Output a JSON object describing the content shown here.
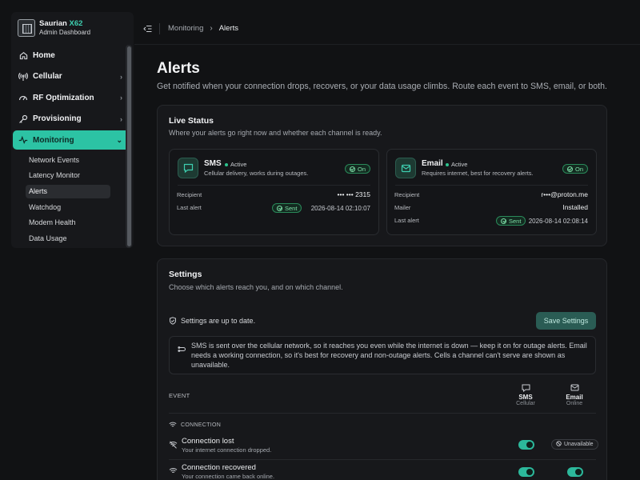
{
  "brand": {
    "name": "Saurian",
    "model": "X62",
    "subtitle": "Admin Dashboard",
    "logo_icon": "device-chip-icon"
  },
  "sidebar": {
    "items": [
      {
        "label": "Home",
        "icon": "home-icon",
        "expandable": false
      },
      {
        "label": "Cellular",
        "icon": "antenna-icon",
        "expandable": true
      },
      {
        "label": "RF Optimization",
        "icon": "gauge-icon",
        "expandable": true
      },
      {
        "label": "Provisioning",
        "icon": "key-icon",
        "expandable": true
      },
      {
        "label": "Monitoring",
        "icon": "pulse-icon",
        "expandable": true,
        "active": true
      }
    ],
    "sub_items": [
      "Network Events",
      "Latency Monitor",
      "Alerts",
      "Watchdog",
      "Modem Health",
      "Data Usage"
    ],
    "active_sub": "Alerts"
  },
  "breadcrumb": {
    "parent": "Monitoring",
    "current": "Alerts"
  },
  "page": {
    "title": "Alerts",
    "description": "Get notified when your connection drops, recovers, or your data usage climbs. Route each event to SMS, email, or both."
  },
  "live_status": {
    "title": "Live Status",
    "description": "Where your alerts go right now and whether each channel is ready.",
    "channels": [
      {
        "name": "SMS",
        "status": "Active",
        "subtitle": "Cellular delivery, works during outages.",
        "badge": "On",
        "icon": "message-icon",
        "rows": [
          {
            "label": "Recipient",
            "value": "••• ••• 2315"
          },
          {
            "label": "Last alert",
            "badge": "Sent",
            "value": "2026-08-14 02:10:07"
          }
        ]
      },
      {
        "name": "Email",
        "status": "Active",
        "subtitle": "Requires internet, best for recovery alerts.",
        "badge": "On",
        "icon": "mail-icon",
        "rows": [
          {
            "label": "Recipient",
            "value": "r•••@proton.me"
          },
          {
            "label": "Mailer",
            "value": "Installed"
          },
          {
            "label": "Last alert",
            "badge": "Sent",
            "value": "2026-08-14 02:08:14"
          }
        ]
      }
    ]
  },
  "settings": {
    "title": "Settings",
    "description": "Choose which alerts reach you, and on which channel.",
    "status_note": "Settings are up to date.",
    "save_label": "Save Settings",
    "info": "SMS is sent over the cellular network, so it reaches you even while the internet is down — keep it on for outage alerts. Email needs a working connection, so it's best for recovery and non-outage alerts. Cells a channel can't serve are shown as unavailable.",
    "table": {
      "event_header": "EVENT",
      "columns": [
        {
          "name": "SMS",
          "sub": "Cellular",
          "icon": "message-icon"
        },
        {
          "name": "Email",
          "sub": "Online",
          "icon": "mail-icon"
        }
      ],
      "group": "CONNECTION",
      "rows": [
        {
          "title": "Connection lost",
          "subtitle": "Your internet connection dropped.",
          "icon": "wifi-off-icon",
          "sms": true,
          "email": "Unavailable"
        },
        {
          "title": "Connection recovered",
          "subtitle": "Your connection came back online.",
          "icon": "wifi-icon",
          "sms": true,
          "email": true
        }
      ]
    }
  }
}
